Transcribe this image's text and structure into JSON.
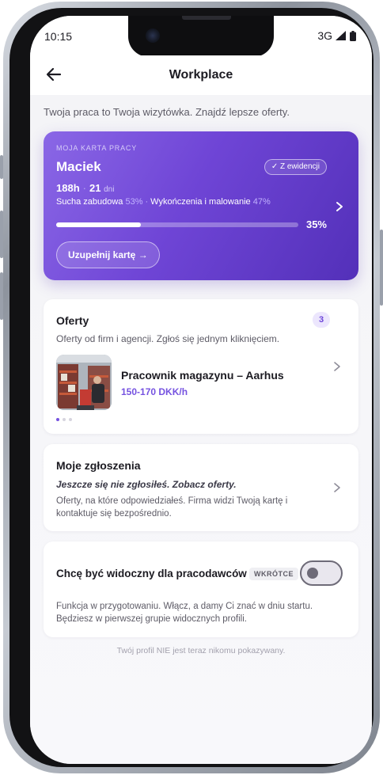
{
  "status": {
    "time": "10:15",
    "network": "3G"
  },
  "header": {
    "title": "Workplace"
  },
  "intro": "Twoja praca to Twoja wizytówka. Znajdź lepsze oferty.",
  "work_card": {
    "eyebrow": "MOJA KARTA PRACY",
    "name": "Maciek",
    "verified_label": "✓ Z ewidencji",
    "hours": "188h",
    "days": "21",
    "days_unit": "dni",
    "skills": [
      {
        "name": "Sucha zabudowa",
        "pct": "53%"
      },
      {
        "name": "Wykończenia i malowanie",
        "pct": "47%"
      }
    ],
    "completion_pct": 35,
    "completion_label": "35%",
    "cta_label": "Uzupełnij kartę →"
  },
  "offers": {
    "title": "Oferty",
    "count": "3",
    "subtitle": "Oferty od firm i agencji. Zgłoś się jednym kliknięciem.",
    "job_title": "Pracownik magazynu – Aarhus",
    "job_rate": "150-170 DKK/h",
    "pager_count": 3,
    "pager_active": 0
  },
  "applications": {
    "title": "Moje zgłoszenia",
    "empty_text": "Jeszcze się nie zgłosiłeś. Zobacz oferty.",
    "description": "Oferty, na które odpowiedziałeś. Firma widzi Twoją kartę i kontaktuje się bezpośrednio."
  },
  "visibility": {
    "title": "Chcę być widoczny dla pracodawców",
    "badge": "WKRÓTCE",
    "enabled": false,
    "description": "Funkcja w przygotowaniu. Włącz, a damy Ci znać w dniu startu. Będziesz w pierwszej grupie widocznych profili."
  },
  "footnote": "Twój profil NIE jest teraz nikomu pokazywany.",
  "colors": {
    "accent": "#7552e0",
    "hero_start": "#8a67e6",
    "hero_end": "#5330b9"
  }
}
